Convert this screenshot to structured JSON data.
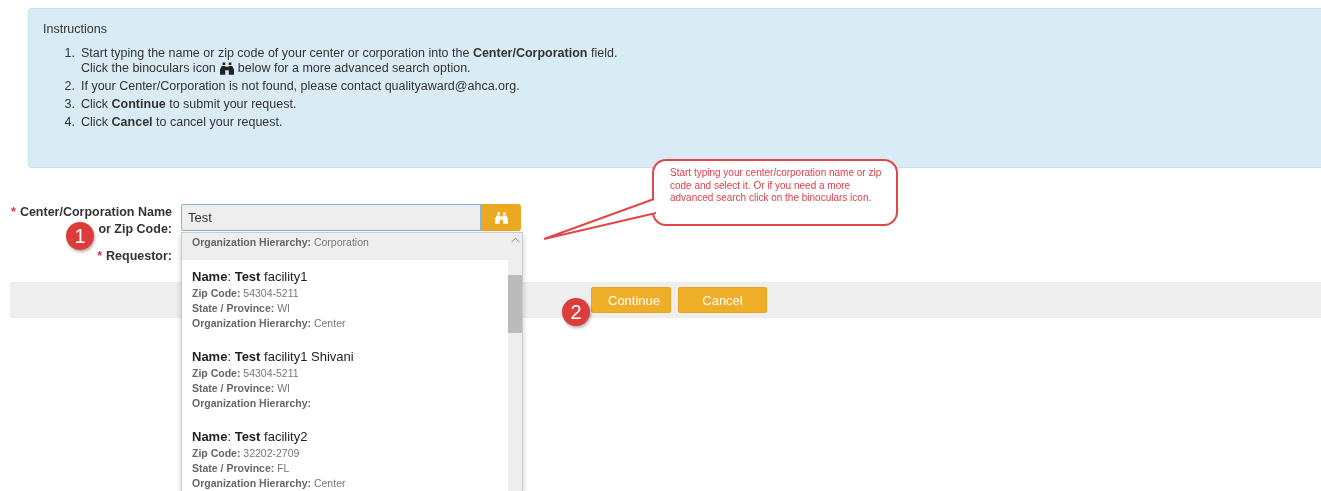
{
  "instructions": {
    "title": "Instructions",
    "steps": [
      {
        "number": "1.",
        "lines": [
          {
            "text": "Start typing the name or zip code of your center or corporation into the **Center/Corporation** field."
          },
          {
            "text": "Click the binoculars icon",
            "kind": "with-icon",
            "after": "below for a more advanced search option."
          }
        ]
      },
      {
        "number": "2.",
        "lines": [
          {
            "text": "If your Center/Corporation is not found, please contact qualityaward@ahca.org."
          }
        ]
      },
      {
        "number": "3.",
        "lines": [
          {
            "text": "Click **Continue** to submit your request."
          }
        ]
      },
      {
        "number": "4.",
        "lines": [
          {
            "text": "Click **Cancel** to cancel your request."
          }
        ]
      }
    ]
  },
  "form": {
    "fields": [
      {
        "label_lines": [
          "Center/Corporation Name",
          "or Zip Code:"
        ],
        "required_mark": "*",
        "value": "Test",
        "kind": "search"
      },
      {
        "label_lines": [
          "Requestor:"
        ],
        "required_mark": "*",
        "kind": "text"
      }
    ],
    "suggestions": [
      {
        "selected": true,
        "details": [
          {
            "label": "Organization Hierarchy:",
            "value": "Corporation"
          }
        ]
      },
      {
        "selected": false,
        "name": "**Name**: **Test** facility1",
        "details": [
          {
            "label": "Zip Code:",
            "value": "54304-5211"
          },
          {
            "label": "State / Province:",
            "value": "WI"
          },
          {
            "label": "Organization Hierarchy:",
            "value": "Center"
          }
        ]
      },
      {
        "selected": false,
        "name": "**Name**: **Test** facility1 Shivani",
        "details": [
          {
            "label": "Zip Code:",
            "value": "54304-5211"
          },
          {
            "label": "State / Province:",
            "value": "WI"
          },
          {
            "label": "Organization Hierarchy:"
          }
        ]
      },
      {
        "selected": false,
        "name": "**Name**: **Test** facility2",
        "details": [
          {
            "label": "Zip Code:",
            "value": "32202-2709"
          },
          {
            "label": "State / Province:",
            "value": "FL"
          },
          {
            "label": "Organization Hierarchy:",
            "value": "Center"
          }
        ]
      }
    ]
  },
  "buttons": [
    "Continue",
    "Cancel"
  ],
  "annotations": {
    "callout": "Start typing your center/corporation name or zip code and select it. Or if you need a more advanced search click on the binoculars icon.",
    "markers": [
      "1",
      "2"
    ]
  }
}
